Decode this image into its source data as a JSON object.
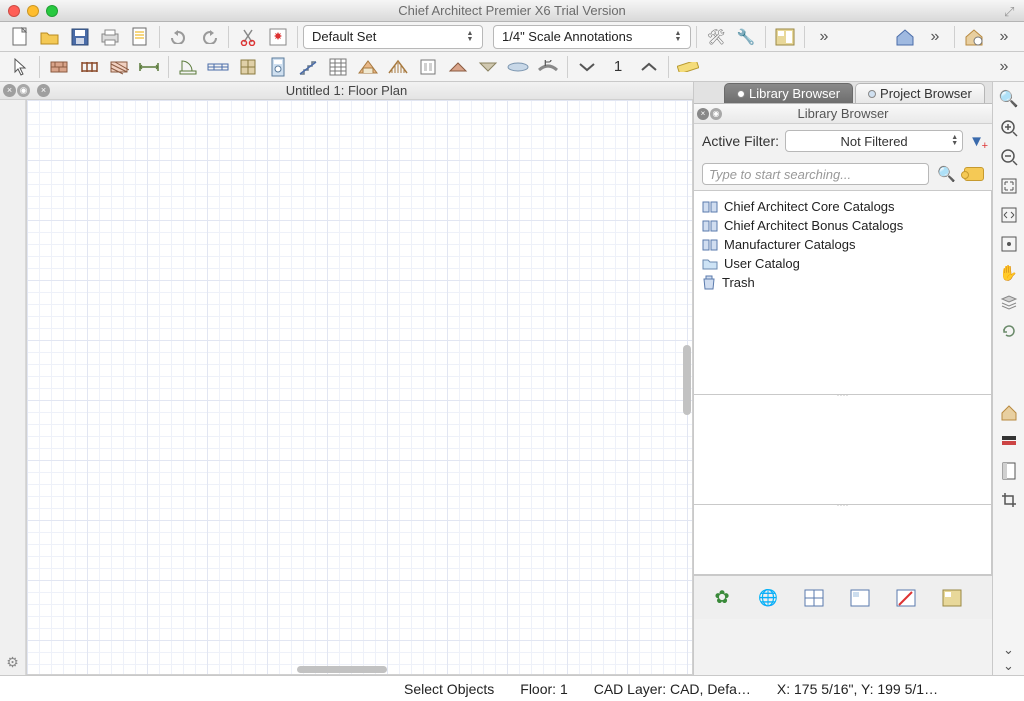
{
  "title": "Chief Architect Premier X6 Trial Version",
  "toolbar1": {
    "default_set": "Default Set",
    "scale": "1/4\" Scale Annotations"
  },
  "floor_number": "1",
  "document": {
    "title": "Untitled 1: Floor Plan"
  },
  "panel": {
    "tabs": {
      "library": "Library Browser",
      "project": "Project Browser"
    },
    "subtitle": "Library Browser",
    "filter_label": "Active Filter:",
    "filter_value": "Not Filtered",
    "search_placeholder": "Type to start searching...",
    "items": [
      "Chief Architect Core Catalogs",
      "Chief Architect Bonus Catalogs",
      "Manufacturer Catalogs",
      "User Catalog",
      "Trash"
    ]
  },
  "status": {
    "mode": "Select Objects",
    "floor": "Floor: 1",
    "layer": "CAD Layer: CAD,  Defa…",
    "coords": "X: 175 5/16\", Y: 199 5/1…"
  }
}
